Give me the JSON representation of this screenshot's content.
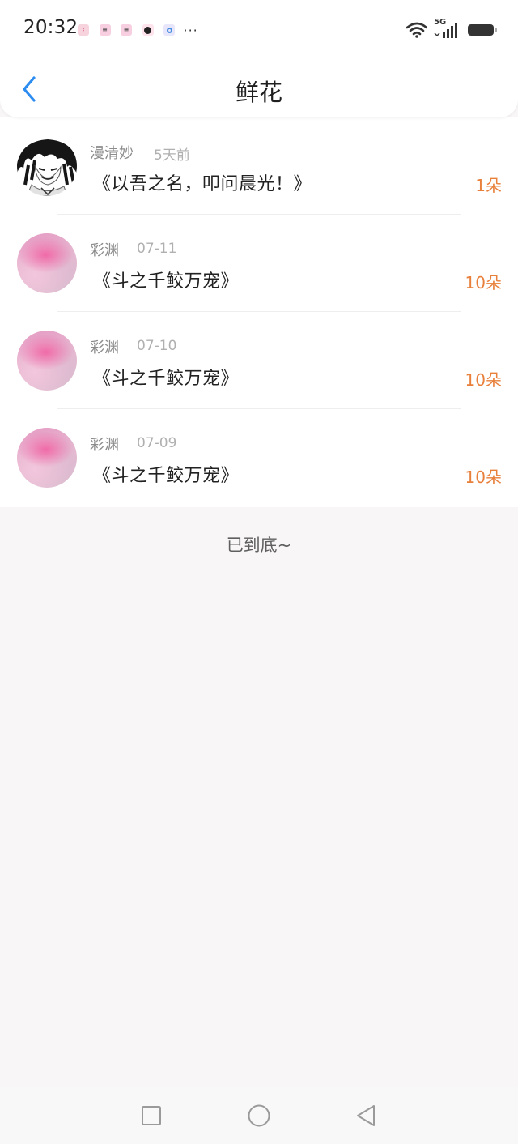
{
  "status_bar": {
    "time": "20:32",
    "network": "5G",
    "notification_icons": [
      "app-notification-icon",
      "message-notification-icon",
      "message-notification-icon",
      "app-notification-icon",
      "browser-notification-icon"
    ],
    "more_indicator": "···"
  },
  "header": {
    "title": "鲜花"
  },
  "colors": {
    "accent_blue": "#2d8cf0",
    "count_orange": "#e87f3a"
  },
  "records": [
    {
      "user": "漫清妙",
      "time": "5天前",
      "book": "《以吾之名，叩问晨光！》",
      "count": "1朵",
      "avatar": "manga-portrait"
    },
    {
      "user": "彩渊",
      "time": "07-11",
      "book": "《斗之千鲛万宠》",
      "count": "10朵",
      "avatar": "pink-flower"
    },
    {
      "user": "彩渊",
      "time": "07-10",
      "book": "《斗之千鲛万宠》",
      "count": "10朵",
      "avatar": "pink-flower"
    },
    {
      "user": "彩渊",
      "time": "07-09",
      "book": "《斗之千鲛万宠》",
      "count": "10朵",
      "avatar": "pink-flower"
    }
  ],
  "footer_text": "已到底~",
  "system_nav": [
    "recents-square-icon",
    "home-circle-icon",
    "back-triangle-icon"
  ]
}
